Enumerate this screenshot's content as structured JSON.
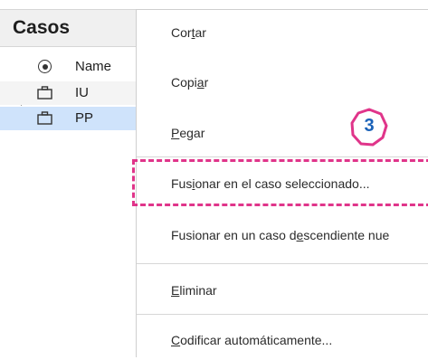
{
  "tree": {
    "title": "Casos",
    "items": [
      {
        "label": "Name",
        "icon": "add-circle-icon"
      },
      {
        "label": "IU",
        "icon": "case-icon"
      },
      {
        "label": "PP",
        "icon": "case-icon",
        "selected": true
      }
    ]
  },
  "menu": {
    "items": [
      {
        "pre": "Cor",
        "u": "t",
        "post": "ar"
      },
      {
        "pre": "Copi",
        "u": "a",
        "post": "r"
      },
      {
        "pre": "",
        "u": "P",
        "post": "egar"
      },
      {
        "pre": "Fus",
        "u": "i",
        "post": "onar en el caso seleccionado..."
      },
      {
        "pre": "Fusionar en un caso d",
        "u": "e",
        "post": "scendiente nue"
      },
      {
        "pre": "",
        "u": "E",
        "post": "liminar"
      },
      {
        "pre": "",
        "u": "C",
        "post": "odificar automáticamente..."
      }
    ]
  },
  "callout": {
    "number": "3",
    "color": "#e0358a",
    "number_color": "#1a62b8"
  }
}
